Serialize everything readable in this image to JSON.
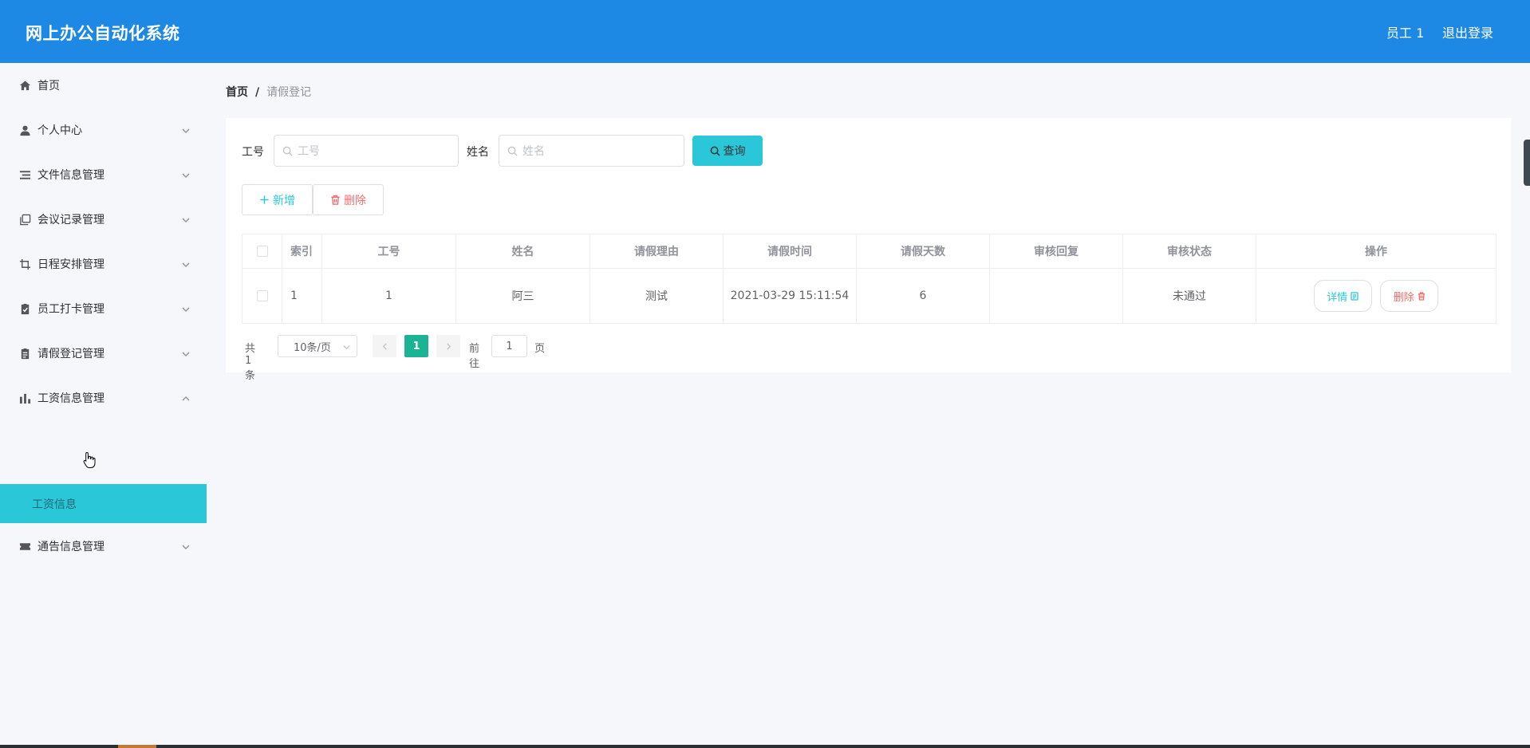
{
  "header": {
    "app_title": "网上办公自动化系统",
    "user_name": "员工 1",
    "logout_label": "退出登录"
  },
  "sidebar": {
    "items": [
      {
        "label": "首页",
        "icon": "home-icon",
        "expandable": false
      },
      {
        "label": "个人中心",
        "icon": "user-icon",
        "expandable": true
      },
      {
        "label": "文件信息管理",
        "icon": "list-icon",
        "expandable": true
      },
      {
        "label": "会议记录管理",
        "icon": "copy-icon",
        "expandable": true
      },
      {
        "label": "日程安排管理",
        "icon": "crop-icon",
        "expandable": true
      },
      {
        "label": "员工打卡管理",
        "icon": "checklist-icon",
        "expandable": true
      },
      {
        "label": "请假登记管理",
        "icon": "clipboard-icon",
        "expandable": true
      },
      {
        "label": "工资信息管理",
        "icon": "bar-chart-icon",
        "expandable": true,
        "expanded": true
      },
      {
        "label": "通告信息管理",
        "icon": "ticket-icon",
        "expandable": true
      }
    ],
    "active_subitem": "工资信息"
  },
  "breadcrumb": {
    "home": "首页",
    "separator": "/",
    "current": "请假登记"
  },
  "search": {
    "id_label": "工号",
    "id_placeholder": "工号",
    "name_label": "姓名",
    "name_placeholder": "姓名",
    "search_button": "查询"
  },
  "toolbar": {
    "add_label": "新增",
    "delete_label": "删除"
  },
  "table": {
    "headers": [
      "索引",
      "工号",
      "姓名",
      "请假理由",
      "请假时间",
      "请假天数",
      "审核回复",
      "审核状态",
      "操作"
    ],
    "rows": [
      {
        "index": "1",
        "emp_id": "1",
        "name": "阿三",
        "reason": "测试",
        "time": "2021-03-29 15:11:54",
        "days": "6",
        "reply": "",
        "status": "未通过",
        "detail_label": "详情",
        "delete_label": "删除"
      }
    ]
  },
  "pagination": {
    "total": "共 1 条",
    "page_size": "10条/页",
    "current_page": "1",
    "goto_label": "前往",
    "goto_value": "1",
    "page_suffix": "页"
  },
  "colors": {
    "header_bg": "#1e88e5",
    "accent_teal": "#2ac7d8",
    "page_active": "#1ab394",
    "danger": "#f56c6c"
  }
}
